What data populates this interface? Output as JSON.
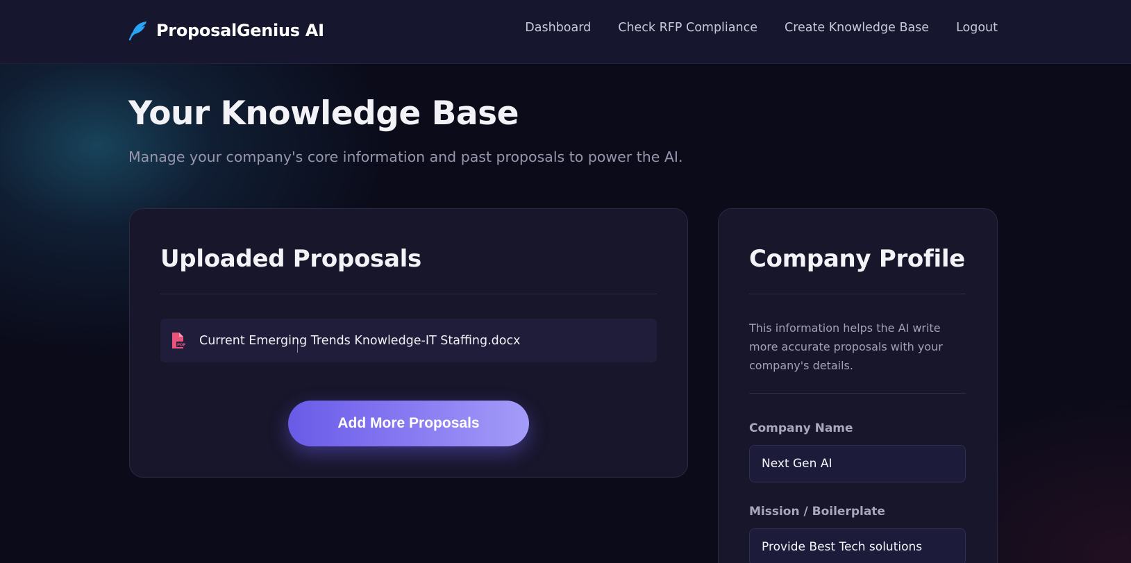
{
  "brand": {
    "name": "ProposalGenius AI",
    "icon": "feather-icon",
    "accent_color": "#29a3f5"
  },
  "nav": {
    "items": [
      {
        "label": "Dashboard"
      },
      {
        "label": "Check RFP Compliance"
      },
      {
        "label": "Create Knowledge Base"
      },
      {
        "label": "Logout"
      }
    ]
  },
  "page": {
    "title": "Your Knowledge Base",
    "subtitle": "Manage your company's core information and past proposals to power the AI."
  },
  "proposals": {
    "title": "Uploaded Proposals",
    "files": [
      {
        "name": "Current Emerging Trends Knowledge-IT Staffing.docx",
        "icon": "pdf-file-icon"
      }
    ],
    "add_button_label": "Add More Proposals",
    "button_color_start": "#6a5be8",
    "button_color_end": "#a49cf8"
  },
  "profile": {
    "title": "Company Profile",
    "description": "This information helps the AI write more accurate proposals with your company's details.",
    "company_name": {
      "label": "Company Name",
      "value": "Next Gen AI"
    },
    "mission": {
      "label": "Mission / Boilerplate",
      "value": "Provide Best Tech solutions"
    }
  },
  "colors": {
    "background": "#0b0b1a",
    "navbar": "#17162f",
    "card": "#17162b",
    "file_icon": "#e9557a"
  }
}
